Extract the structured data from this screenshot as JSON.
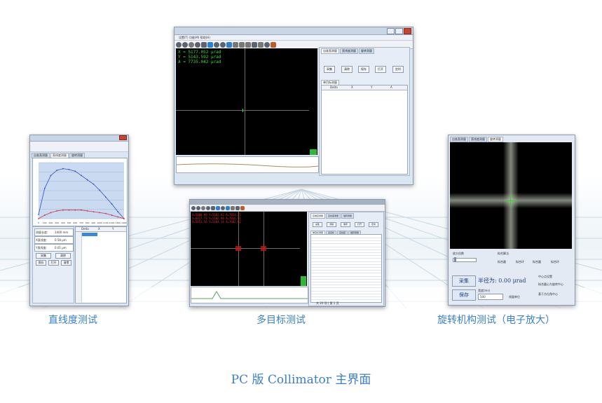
{
  "captions": {
    "left": "直线度测试",
    "center": "多目标测试",
    "right": "旋转机构测试（电子放大）",
    "main": "PC 版 Collimator 主界面"
  },
  "top_window": {
    "menu": "设置(T)   功能(M)   帮助(H)",
    "readout": [
      "X = 5177.052 μrad",
      "Y = 5143.592 μrad",
      "A = 7735.042 μrad"
    ],
    "tabs": [
      "自准直测量",
      "直线度测量",
      "旋转测量"
    ],
    "buttons": [
      "采集",
      "清除",
      "保存",
      "打开",
      "定时"
    ],
    "grid_tab": "单目标测量",
    "grid_headers": [
      "Delta",
      "X",
      "Y",
      "A"
    ]
  },
  "left_window": {
    "tabs": [
      "自准直测量",
      "直线度测量",
      "旋转测量"
    ],
    "fields": [
      {
        "label": "测量长度:",
        "value": "1400 mm"
      },
      {
        "label": "X直线度:",
        "value": "0.58 μm"
      },
      {
        "label": "Y直线度:",
        "value": "0.01 μm"
      }
    ],
    "buttons": [
      "采集",
      "清除",
      "保存",
      "打开",
      "清零"
    ],
    "grid_headers": [
      "Delta",
      "X",
      "Y"
    ],
    "x_ticks": [
      "0",
      "100",
      "200",
      "300",
      "400",
      "500",
      "600",
      "700",
      "800",
      "900",
      "1000",
      "1100",
      "1200",
      "1300",
      "1400"
    ],
    "series": [
      {
        "name": "X",
        "color": "#3050c0",
        "values": [
          0.05,
          0.35,
          0.5,
          0.56,
          0.58,
          0.57,
          0.55,
          0.5,
          0.45,
          0.4,
          0.33,
          0.25,
          0.17,
          0.08,
          0.0
        ]
      },
      {
        "name": "Y",
        "color": "#d0304a",
        "values": [
          0.0,
          0.04,
          0.07,
          0.09,
          0.1,
          0.1,
          0.1,
          0.1,
          0.09,
          0.08,
          0.07,
          0.06,
          0.04,
          0.02,
          0.0
        ]
      }
    ]
  },
  "center_window": {
    "readout": [
      "X=5880.09 Y=5182.82 A=7851.25",
      "X=6117.73 Y=5182.98 A=7916.91",
      "X=5651.56 Y=5184.14 A=7682.02"
    ],
    "tabs": [
      "自准直测量",
      "直线度测量",
      "旋转测量"
    ],
    "buttons": [
      "采集",
      "清除",
      "保存",
      "打开",
      "定时"
    ],
    "grid_tabs": [
      "单目标测量",
      "多目标",
      "直线度",
      "旋转测量",
      "多目标测量"
    ],
    "status": "共 20 项 | 第 1 页"
  },
  "right_window": {
    "tabs": [
      "自准直测量",
      "直线度测量",
      "旋转测量"
    ],
    "zoom_label": "放大倍数",
    "circle_label": "拟合算法",
    "options": [
      "拟合圆",
      "拟合环",
      "拟合圆",
      "拟合环"
    ],
    "radius": "半径为: 0.00 μrad",
    "collect": "采集",
    "save": "保存",
    "width_label": "宽度(ms)",
    "width_value": "500",
    "line_label": "线量单位",
    "center_label": "中心点设置",
    "center_opts": [
      "拟合圆心为旋转中心",
      "基于方位角中心"
    ]
  }
}
